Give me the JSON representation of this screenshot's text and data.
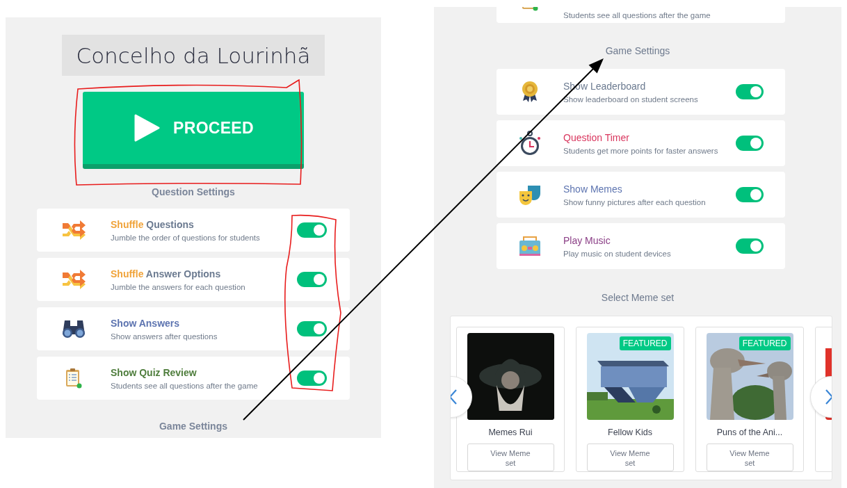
{
  "left_panel": {
    "title": "Concelho da Lourinhã",
    "proceed_button": {
      "label": "PROCEED"
    },
    "question_settings": {
      "heading": "Question Settings",
      "items": [
        {
          "kind": "shuffle",
          "accent": "Shuffle",
          "title": "Questions",
          "description": "Jumble the order of questions for students",
          "on": true
        },
        {
          "kind": "shuffle",
          "accent": "Shuffle",
          "title": "Answer Options",
          "description": "Jumble the answers for each question",
          "on": true
        },
        {
          "kind": "binoculars",
          "title": "Show Answers",
          "description": "Show answers after questions",
          "on": true
        },
        {
          "kind": "clipboard",
          "title": "Show Quiz Review",
          "description": "Students see all questions after the game",
          "on": true
        }
      ]
    },
    "footer_heading": "Game Settings"
  },
  "right_panel": {
    "partial_item": {
      "kind": "clipboard",
      "description": "Students see all questions after the game"
    },
    "game_settings": {
      "heading": "Game Settings",
      "items": [
        {
          "kind": "medal",
          "title": "Show Leaderboard",
          "description": "Show leaderboard on student screens",
          "on": true
        },
        {
          "kind": "stopwatch",
          "title": "Question Timer",
          "description": "Students get more points for faster answers",
          "on": true
        },
        {
          "kind": "masks",
          "title": "Show Memes",
          "description": "Show funny pictures after each question",
          "on": true
        },
        {
          "kind": "radio",
          "title": "Play Music",
          "description": "Play music on student devices",
          "on": true
        }
      ]
    },
    "meme_sets": {
      "heading": "Select Meme set",
      "cards": [
        {
          "kind": "card",
          "name": "Memes Rui",
          "button": "View Meme set"
        },
        {
          "kind": "card",
          "name": "Fellow Kids",
          "badge": "FEATURED",
          "button": "View Meme set"
        },
        {
          "kind": "card",
          "name": "Puns of the Ani...",
          "badge": "FEATURED",
          "button": "View Meme set"
        },
        {
          "kind": "picture"
        }
      ]
    }
  }
}
